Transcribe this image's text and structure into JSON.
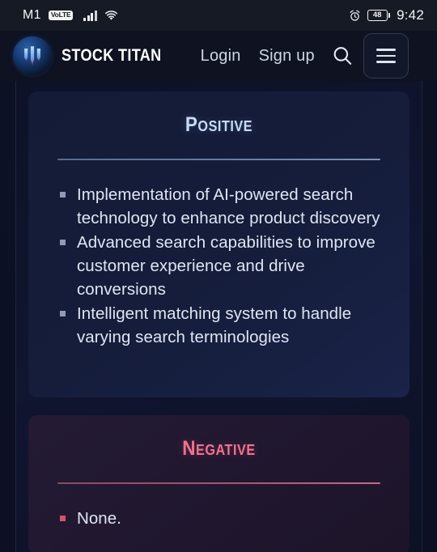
{
  "statusbar": {
    "carrier": "M1",
    "network_badge": "VoLTE",
    "signal_icon": "cellular-signal-icon",
    "wifi_icon": "wifi-icon",
    "alarm_icon": "alarm-clock-icon",
    "battery_level": "48",
    "time": "9:42"
  },
  "header": {
    "logo_icon": "stock-titan-logo-icon",
    "brand": "STOCK TITAN",
    "login_label": "Login",
    "signup_label": "Sign up",
    "search_icon": "search-icon",
    "menu_icon": "hamburger-menu-icon"
  },
  "cards": [
    {
      "id": "positive",
      "title": "Positive",
      "accent": "#c9dcf5",
      "bullet_color": "#8d9ab8",
      "items": [
        "Implementation of AI-powered search technology to enhance product discovery",
        "Advanced search capabilities to improve customer experience and drive conversions",
        "Intelligent matching system to handle varying search terminologies"
      ]
    },
    {
      "id": "negative",
      "title": "Negative",
      "accent": "#f4718f",
      "bullet_color": "#d4526f",
      "items": [
        "None."
      ]
    }
  ]
}
